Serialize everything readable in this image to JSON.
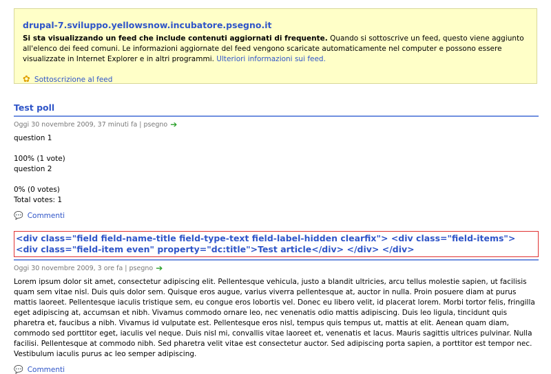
{
  "feed": {
    "title": "drupal-7.sviluppo.yellowsnow.incubatore.psegno.it",
    "desc_bold": "Si sta visualizzando un feed che include contenuti aggiornati di frequente.",
    "desc": " Quando si sottoscrive un feed, questo viene aggiunto all'elenco dei feed comuni. Le informazioni aggiornate del feed vengono scaricate automaticamente nel computer e possono essere visualizzate in Internet Explorer e in altri programmi. ",
    "more_link": "Ulteriori informazioni sui feed.",
    "subscribe": "Sottoscrizione al feed"
  },
  "poll": {
    "title": "Test poll",
    "meta": "Oggi 30 novembre 2009, 37 minuti fa | psegno",
    "q1": "question 1",
    "q1_result": "100% (1 vote)",
    "q2": "question 2",
    "q2_result": "0% (0 votes)",
    "total": "Total votes: 1",
    "comments": "Commenti"
  },
  "article": {
    "title": "<div class=\"field field-name-title field-type-text field-label-hidden clearfix\"> <div class=\"field-items\"> <div class=\"field-item even\" property=\"dc:title\">Test article</div> </div> </div>",
    "meta": "Oggi 30 novembre 2009, 3 ore fa | psegno",
    "body": "Lorem ipsum dolor sit amet, consectetur adipiscing elit. Pellentesque vehicula, justo a blandit ultricies, arcu tellus molestie sapien, ut facilisis quam sem vitae nisl. Duis quis dolor sem. Quisque eros augue, varius viverra pellentesque at, auctor in nulla. Proin posuere diam at purus mattis laoreet. Pellentesque iaculis tristique sem, eu congue eros lobortis vel. Donec eu libero velit, id placerat lorem. Morbi tortor felis, fringilla eget adipiscing at, accumsan et nibh. Vivamus commodo ornare leo, nec venenatis odio mattis adipiscing. Duis leo ligula, tincidunt quis pharetra et, faucibus a nibh. Vivamus id vulputate est. Pellentesque eros nisl, tempus quis tempus ut, mattis at elit. Aenean quam diam, commodo sed porttitor eget, iaculis vel neque. Duis nisl mi, convallis vitae laoreet et, venenatis et lacus. Mauris sagittis ultrices pulvinar. Nulla facilisi. Pellentesque at commodo nibh. Sed pharetra velit vitae est consectetur auctor. Sed adipiscing porta sapien, a porttitor est tempor nec. Vestibulum iaculis purus ac leo semper adipiscing.",
    "comments": "Commenti"
  }
}
